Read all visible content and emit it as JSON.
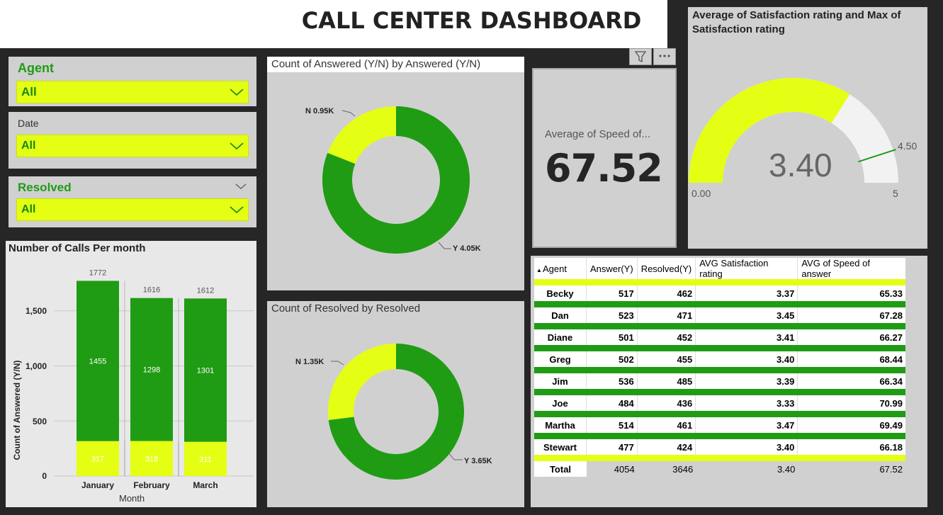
{
  "dashboard": {
    "title": "CALL CENTER DASHBOARD"
  },
  "slicers": {
    "agent": {
      "label": "Agent",
      "value": "All"
    },
    "date": {
      "label": "Date",
      "value": "All"
    },
    "resolved": {
      "label": "Resolved",
      "value": "All"
    }
  },
  "colors": {
    "green": "#1f9c14",
    "lime": "#e4ff13",
    "panel": "#d0d0d0",
    "background": "#262626"
  },
  "icons": {
    "filter": "filter-icon",
    "more": "more-options-icon"
  },
  "answered_donut": {
    "title": "Count of Answered (Y/N) by Answered (Y/N)",
    "n_label": "N 0.95K",
    "y_label": "Y 4.05K"
  },
  "resolved_donut": {
    "title": "Count of Resolved by Resolved",
    "n_label": "N 1.35K",
    "y_label": "Y 3.65K"
  },
  "speed_card": {
    "label": "Average of Speed of...",
    "value": "67.52"
  },
  "gauge": {
    "title": "Average of Satisfaction rating and Max of Satisfaction rating",
    "value_label": "3.40",
    "min_label": "0.00",
    "max_label": "5",
    "target_label": "4.50"
  },
  "calls_chart": {
    "title": "Number of Calls Per month",
    "ylabel": "Count of Answered (Y/N)",
    "xlabel": "Month",
    "y_ticks": [
      "1,500",
      "1,000",
      "500",
      "0"
    ]
  },
  "agent_table": {
    "headers": [
      "Agent",
      "Answer(Y)",
      "Resolved(Y)",
      "AVG Satisfaction rating",
      "AVG of Speed of answer"
    ],
    "rows": [
      [
        "Becky",
        "517",
        "462",
        "3.37",
        "65.33"
      ],
      [
        "Dan",
        "523",
        "471",
        "3.45",
        "67.28"
      ],
      [
        "Diane",
        "501",
        "452",
        "3.41",
        "66.27"
      ],
      [
        "Greg",
        "502",
        "455",
        "3.40",
        "68.44"
      ],
      [
        "Jim",
        "536",
        "485",
        "3.39",
        "66.34"
      ],
      [
        "Joe",
        "484",
        "436",
        "3.33",
        "70.99"
      ],
      [
        "Martha",
        "514",
        "461",
        "3.47",
        "69.49"
      ],
      [
        "Stewart",
        "477",
        "424",
        "3.40",
        "66.18"
      ]
    ],
    "total": [
      "Total",
      "4054",
      "3646",
      "3.40",
      "67.52"
    ]
  },
  "chart_data": [
    {
      "type": "bar",
      "title": "Number of Calls Per month",
      "xlabel": "Month",
      "ylabel": "Count of Answered (Y/N)",
      "categories": [
        "January",
        "February",
        "March"
      ],
      "series": [
        {
          "values": [
            317,
            318,
            311
          ],
          "color": "#e4ff13"
        },
        {
          "values": [
            1455,
            1298,
            1301
          ],
          "color": "#1f9c14"
        }
      ],
      "totals": [
        1772,
        1616,
        1612
      ],
      "ylim": [
        0,
        1800
      ],
      "stacked": true,
      "grid": true
    },
    {
      "type": "pie",
      "title": "Count of Answered (Y/N) by Answered (Y/N)",
      "categories": [
        "N",
        "Y"
      ],
      "values": [
        0.95,
        4.05
      ],
      "unit": "K",
      "donut": true
    },
    {
      "type": "pie",
      "title": "Count of Resolved by Resolved",
      "categories": [
        "N",
        "Y"
      ],
      "values": [
        1.35,
        3.65
      ],
      "unit": "K",
      "donut": true
    },
    {
      "type": "gauge",
      "title": "Average of Satisfaction rating and Max of Satisfaction rating",
      "value": 3.4,
      "min": 0,
      "max": 5,
      "target": 4.5
    }
  ]
}
